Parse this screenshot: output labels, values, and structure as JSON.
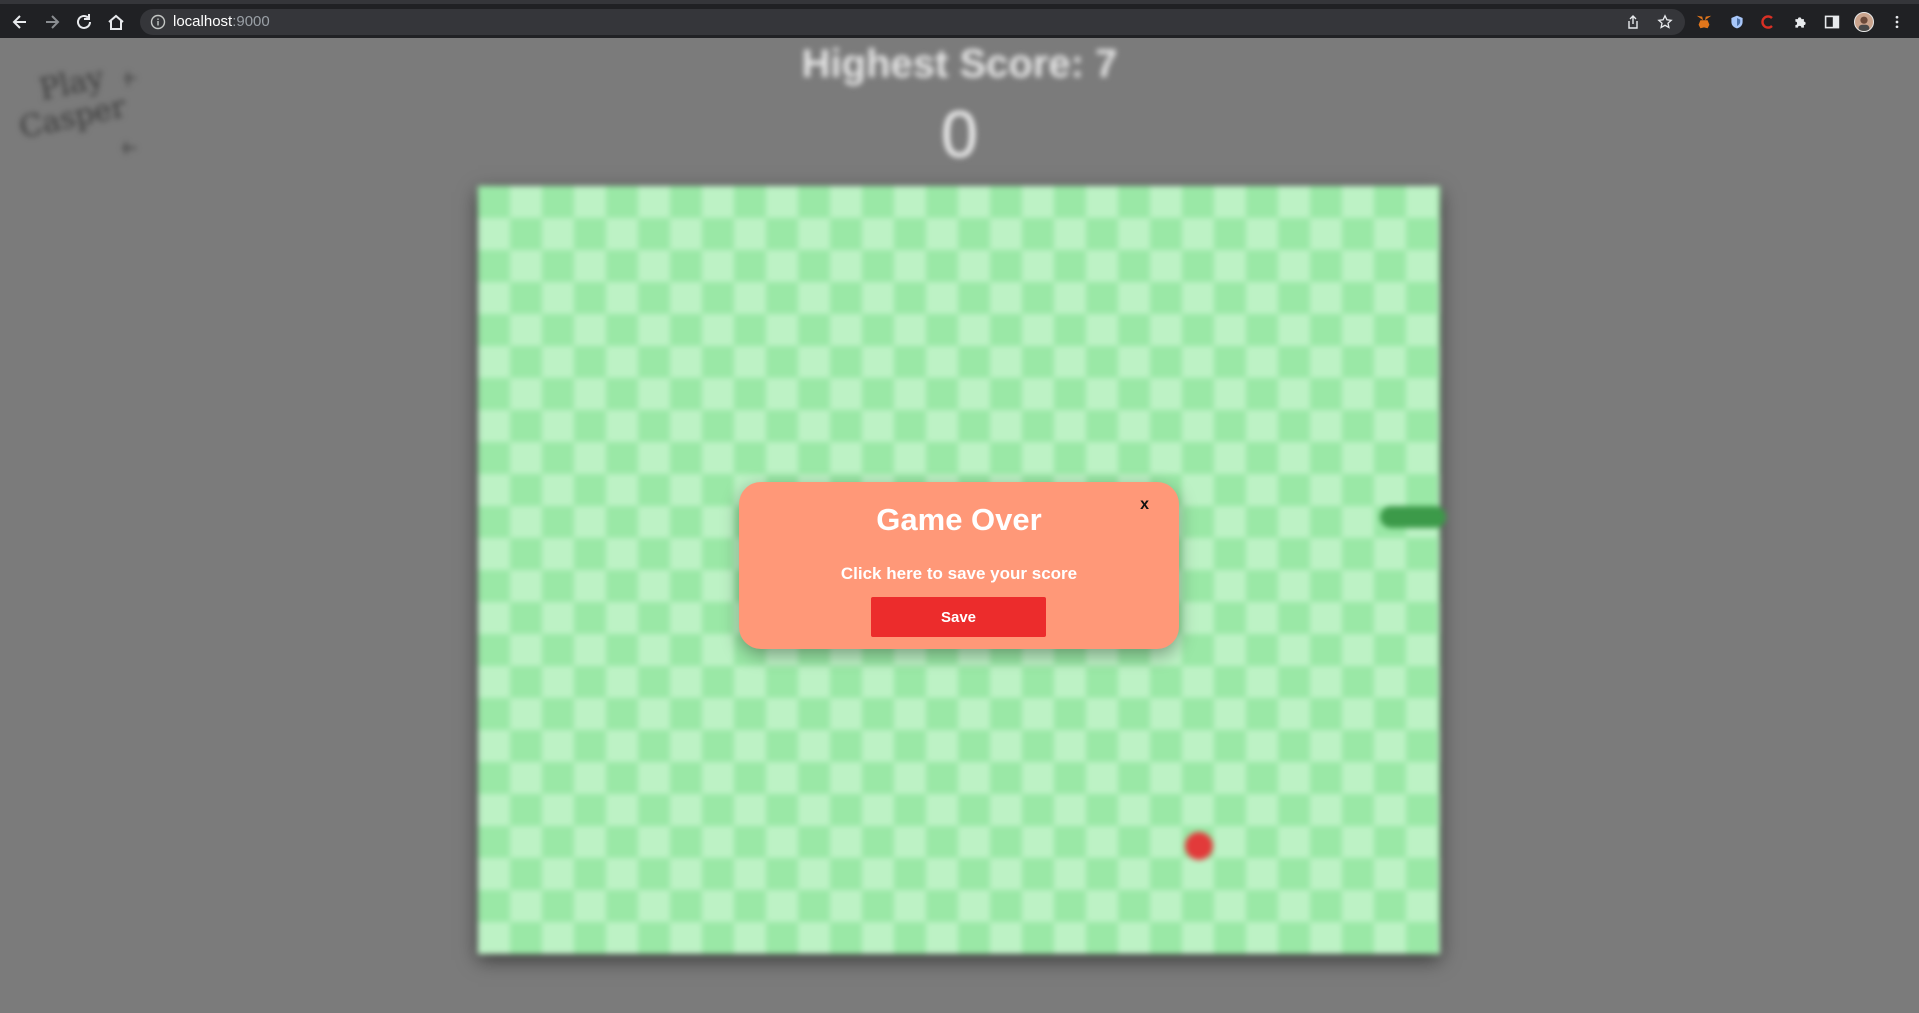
{
  "browser": {
    "url_host": "localhost",
    "url_port": ":9000"
  },
  "page": {
    "logo_lines": [
      "Play",
      "Casper"
    ],
    "highest_score_text": "Highest Score: 7",
    "current_score": "0"
  },
  "modal": {
    "close_label": "x",
    "title": "Game Over",
    "message": "Click here to save your score",
    "save_label": "Save"
  },
  "colors": {
    "board_light": "#bdf2c5",
    "board_dark": "#9ae8a6",
    "modal_bg": "#ff9878",
    "save_button": "#ec2c2c",
    "food": "#e23a3a",
    "snake": "#3c9a49"
  },
  "icons": [
    "back-icon",
    "forward-icon",
    "reload-icon",
    "home-icon",
    "info-icon",
    "share-icon",
    "bookmark-star-icon",
    "metamask-icon",
    "shield-extension-icon",
    "casper-extension-icon",
    "puzzle-extensions-icon",
    "side-panel-icon",
    "profile-avatar",
    "more-menu-icon"
  ]
}
